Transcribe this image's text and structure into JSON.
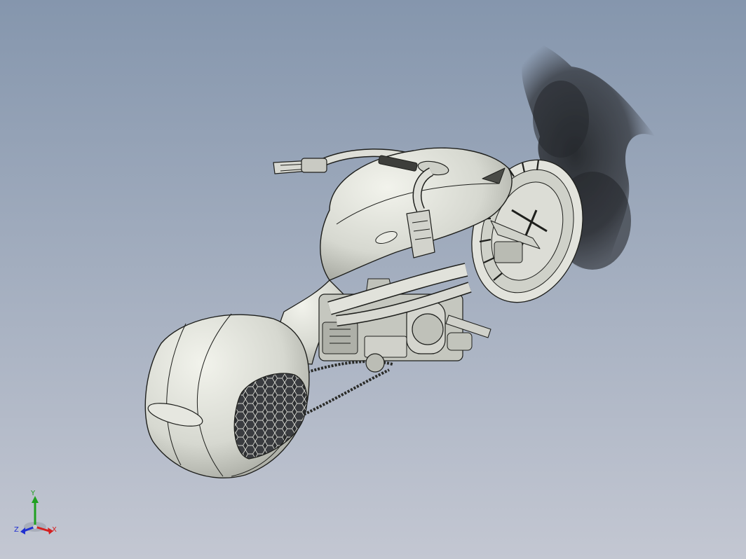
{
  "app": {
    "window_title": ""
  },
  "viewport": {
    "background_top": "#8596ad",
    "background_bottom": "#c3c7d2",
    "model_fill": "#d6d8d0",
    "model_shadow_tone": "#1a1c1e",
    "model_name": "motorcycle"
  },
  "triad": {
    "y_label": "Y",
    "x_label": "X",
    "z_label": "Z",
    "colors": {
      "x": "#d42020",
      "y": "#20a020",
      "z": "#2030d0"
    }
  }
}
